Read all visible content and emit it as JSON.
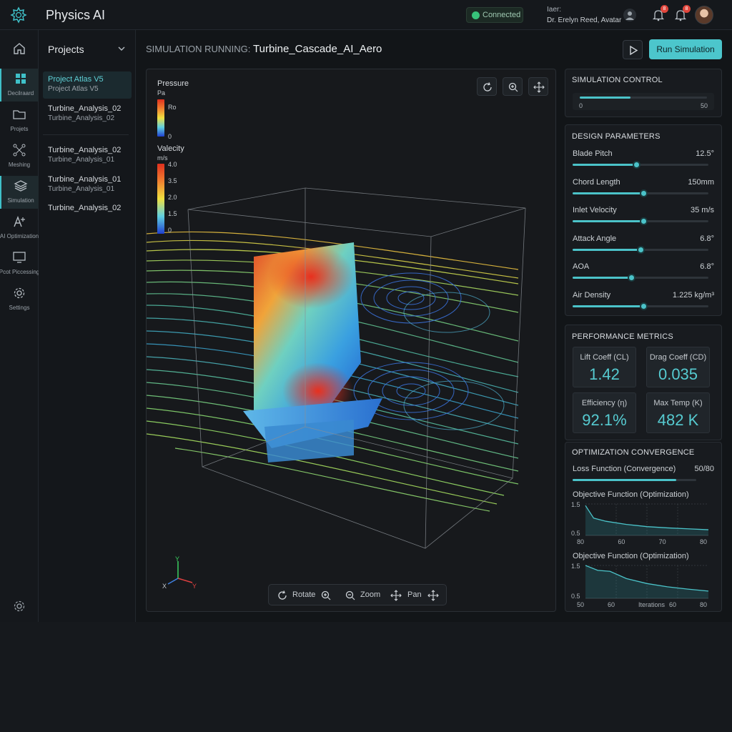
{
  "app": {
    "title": "Physics AI"
  },
  "topbar": {
    "status": "Connected",
    "user_label": "Iaer:",
    "user_name": "Dr. Erelyn Reed, Avatar",
    "notif1": "8",
    "notif2": "8"
  },
  "nav": {
    "items": [
      {
        "label": "Decilraard"
      },
      {
        "label": "Projets"
      },
      {
        "label": "Meshing"
      },
      {
        "label": "Simulation"
      },
      {
        "label": "AI Optimization"
      },
      {
        "label": "Pcot Piccessing"
      },
      {
        "label": "Settings"
      }
    ]
  },
  "projects": {
    "title": "Projects",
    "items": [
      {
        "title": "Project Atlas V5",
        "sub": "Project Atlas V5"
      },
      {
        "title": "Turbine_Analysis_02",
        "sub": "Turbine_Analysis_02"
      },
      {
        "title": "Turbine_Analysis_02",
        "sub": "Turbine_Analysis_01"
      },
      {
        "title": "Turbine_Analysis_01",
        "sub": "Turbine_Analysis_01"
      },
      {
        "title": "Turbine_Analysis_02",
        "sub": ""
      }
    ]
  },
  "header": {
    "prefix": "SIMULATION RUNNING:",
    "name": "Turbine_Cascade_AI_Aero",
    "run_label": "Run Simulation"
  },
  "viewport": {
    "pressure": {
      "title": "Pressure",
      "unit": "Pa",
      "top": "Ro",
      "bottom": "0"
    },
    "velocity": {
      "title": "Valecity",
      "unit": "m/s",
      "ticks": [
        "4.0",
        "3.5",
        "2.0",
        "1.5",
        "0"
      ]
    },
    "axes": {
      "x": "X",
      "y": "Y",
      "z": "Y"
    },
    "toolbar": {
      "rotate": "Rotate",
      "zoom": "Zoom",
      "pan": "Pan"
    },
    "colors": {
      "accent": "#4bc3c9"
    }
  },
  "sim_control": {
    "title": "SIMULATION CONTROL",
    "min": "0",
    "max": "50",
    "progress": 0.4
  },
  "design": {
    "title": "DESIGN PARAMETERS",
    "params": [
      {
        "label": "Blade Pitch",
        "value": "12.5°",
        "level": 0.47
      },
      {
        "label": "Chord Length",
        "value": "150mm",
        "level": 0.52
      },
      {
        "label": "Inlet Velocity",
        "value": "35 m/s",
        "level": 0.52
      },
      {
        "label": "Attack Angle",
        "value": "6.8°",
        "level": 0.5
      },
      {
        "label": "AOA",
        "value": "6.8°",
        "level": 0.43
      },
      {
        "label": "Air Density",
        "value": "1.225 kg/m³",
        "level": 0.52
      }
    ]
  },
  "metrics": {
    "title": "PERFORMANCE METRICS",
    "items": [
      {
        "label": "Lift Coeff (CL)",
        "value": "1.42"
      },
      {
        "label": "Drag Coeff (CD)",
        "value": "0.035"
      },
      {
        "label": "Efficiency (η)",
        "value": "92.1%"
      },
      {
        "label": "Max Temp (K)",
        "value": "482 K"
      }
    ]
  },
  "convergence": {
    "title": "OPTIMIZATION CONVERGENCE",
    "loss_label": "Loss Function (Convergence)",
    "loss_value": "50/80",
    "loss_progress": 0.84,
    "chart1": {
      "title": "Objective Function (Optimization)",
      "ymax": "1.5",
      "ymin": "0.5",
      "xticks": [
        "80",
        "60",
        "70",
        "80"
      ]
    },
    "chart2": {
      "title": "Objective Function (Optimization)",
      "ymax": "1.5",
      "ymin": "0.5",
      "xticks": [
        "50",
        "60",
        "Iterations",
        "60",
        "80"
      ]
    }
  },
  "chart_data": [
    {
      "type": "area",
      "title": "Objective Function (Optimization)",
      "x": [
        50,
        52,
        55,
        60,
        65,
        70,
        75,
        80
      ],
      "y": [
        1.45,
        1.05,
        0.95,
        0.85,
        0.78,
        0.74,
        0.71,
        0.68
      ],
      "ylim": [
        0.5,
        1.5
      ]
    },
    {
      "type": "area",
      "title": "Objective Function (Optimization)",
      "x": [
        50,
        53,
        56,
        60,
        65,
        70,
        75,
        80
      ],
      "y": [
        1.5,
        1.35,
        1.32,
        1.1,
        0.95,
        0.85,
        0.78,
        0.72
      ],
      "ylim": [
        0.5,
        1.5
      ]
    }
  ]
}
